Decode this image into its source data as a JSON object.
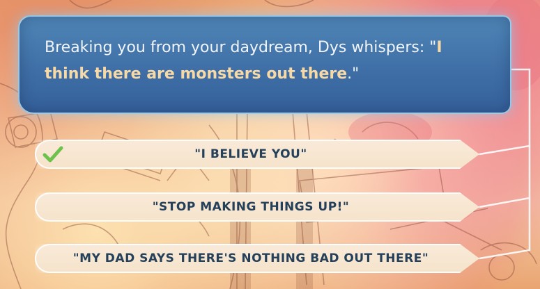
{
  "dialog": {
    "text_plain": "Breaking you from your daydream, Dys whispers: \"",
    "text_highlight": "I think there are monsters out there",
    "text_end": ".\""
  },
  "choices": [
    {
      "label": "\"I BELIEVE YOU\"",
      "selected": true
    },
    {
      "label": "\"STOP MAKING THINGS UP!\"",
      "selected": false
    },
    {
      "label": "\"MY DAD SAYS THERE'S NOTHING BAD OUT THERE\"",
      "selected": false
    }
  ],
  "colors": {
    "dialog_bg": "#3f6fa6",
    "highlight": "#f7d9a6",
    "choice_text": "#24405a",
    "check": "#6cc24a"
  },
  "icons": {
    "selected": "checkmark-icon"
  }
}
